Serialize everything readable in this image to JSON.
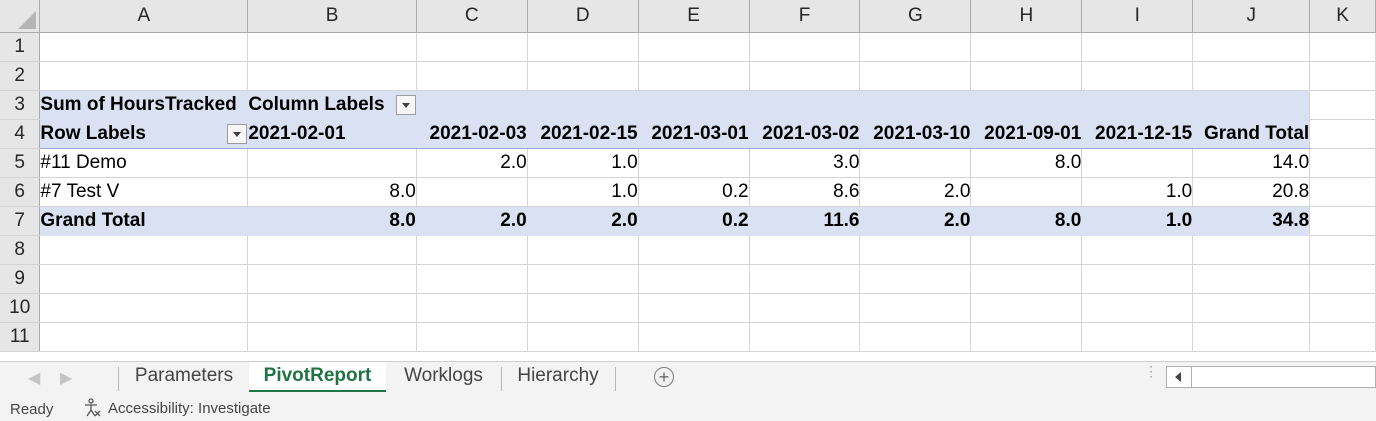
{
  "columns": [
    "A",
    "B",
    "C",
    "D",
    "E",
    "F",
    "G",
    "H",
    "I",
    "J",
    "K"
  ],
  "rows": [
    "1",
    "2",
    "3",
    "4",
    "5",
    "6",
    "7",
    "8",
    "9",
    "10",
    "11"
  ],
  "pivot": {
    "value_label": "Sum of HoursTracked",
    "column_labels": "Column Labels",
    "row_labels": "Row Labels",
    "dates": [
      "2021-02-01",
      "2021-02-03",
      "2021-02-15",
      "2021-03-01",
      "2021-03-02",
      "2021-03-10",
      "2021-09-01",
      "2021-12-15",
      "Grand Total"
    ],
    "data_rows": [
      {
        "label": "#11 Demo",
        "values": [
          "",
          "2.0",
          "1.0",
          "",
          "3.0",
          "",
          "8.0",
          "",
          "14.0"
        ]
      },
      {
        "label": "#7 Test V",
        "values": [
          "8.0",
          "",
          "1.0",
          "0.2",
          "8.6",
          "2.0",
          "",
          "1.0",
          "20.8"
        ]
      }
    ],
    "total": {
      "label": "Grand Total",
      "values": [
        "8.0",
        "2.0",
        "2.0",
        "0.2",
        "11.6",
        "2.0",
        "8.0",
        "1.0",
        "34.8"
      ]
    }
  },
  "sheet_tabs": [
    {
      "label": "Parameters",
      "active": false
    },
    {
      "label": "PivotReport",
      "active": true
    },
    {
      "label": "Worklogs",
      "active": false
    },
    {
      "label": "Hierarchy",
      "active": false
    }
  ],
  "status": {
    "ready": "Ready",
    "accessibility": "Accessibility: Investigate"
  },
  "colors": {
    "accent": "#217346",
    "pivot_band": "#d9e1f2"
  },
  "icons": {
    "add_sheet": "plus-circle-icon",
    "accessibility": "accessibility-icon",
    "filter": "dropdown-filter-icon"
  }
}
